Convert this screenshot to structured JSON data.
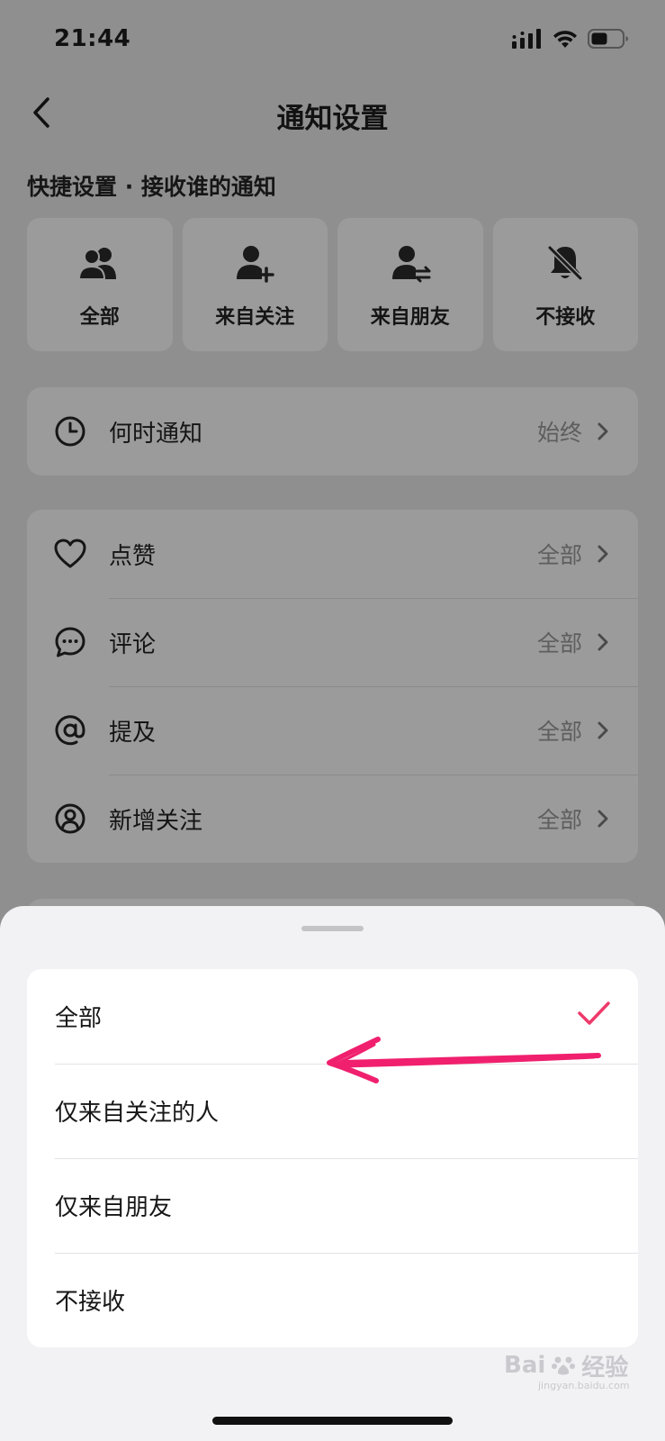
{
  "status_bar": {
    "time": "21:44"
  },
  "nav": {
    "title": "通知设置"
  },
  "quick_settings": {
    "section_title": "快捷设置 · 接收谁的通知",
    "items": [
      {
        "label": "全部",
        "icon": "people-icon"
      },
      {
        "label": "来自关注",
        "icon": "person-add-icon"
      },
      {
        "label": "来自朋友",
        "icon": "person-swap-icon"
      },
      {
        "label": "不接收",
        "icon": "bell-off-icon"
      }
    ]
  },
  "when_card": {
    "label": "何时通知",
    "value": "始终",
    "icon": "clock-icon"
  },
  "types_card": {
    "rows": [
      {
        "label": "点赞",
        "value": "全部",
        "icon": "heart-icon"
      },
      {
        "label": "评论",
        "value": "全部",
        "icon": "comment-icon"
      },
      {
        "label": "提及",
        "value": "全部",
        "icon": "at-icon"
      },
      {
        "label": "新增关注",
        "value": "全部",
        "icon": "follower-icon"
      }
    ]
  },
  "sheet": {
    "options": [
      {
        "label": "全部",
        "selected": true
      },
      {
        "label": "仅来自关注的人",
        "selected": false
      },
      {
        "label": "仅来自朋友",
        "selected": false
      },
      {
        "label": "不接收",
        "selected": false
      }
    ]
  },
  "watermark": {
    "brand": "Bai",
    "brand2": "经验",
    "sub": "jingyan.baidu.com"
  },
  "colors": {
    "accent_check": "#ee3a6a",
    "annotation_arrow": "#f0206e",
    "overlay": "#8f8f8f"
  }
}
